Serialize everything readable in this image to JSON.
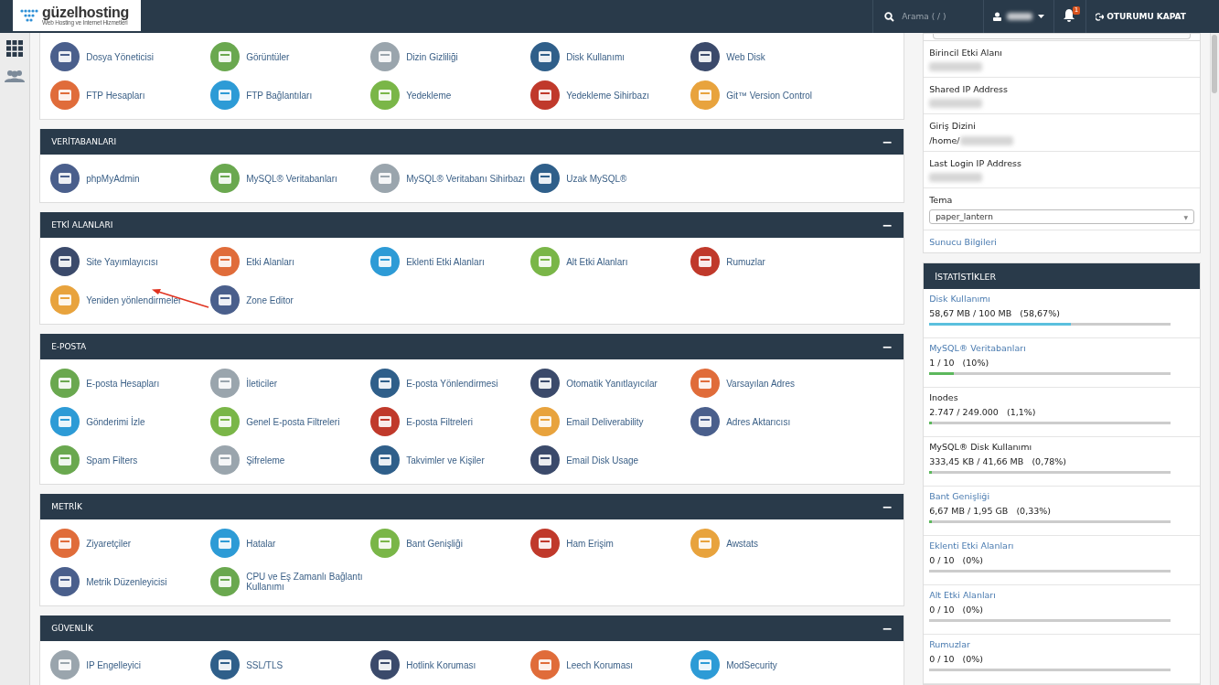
{
  "brand": {
    "name": "güzelhosting",
    "tagline": "Web Hosting ve İnternet Hizmetleri"
  },
  "topbar": {
    "search_placeholder": "Arama ( / )",
    "notification_count": "1",
    "logout": "OTURUMU KAPAT"
  },
  "sections": [
    {
      "items": [
        "Dosya Yöneticisi",
        "Görüntüler",
        "Dizin Gizliliği",
        "Disk Kullanımı",
        "Web Disk",
        "FTP Hesapları",
        "FTP Bağlantıları",
        "Yedekleme",
        "Yedekleme Sihirbazı",
        "Git™ Version Control"
      ]
    },
    {
      "title": "VERİTABANLARI",
      "toggle": "−",
      "items": [
        "phpMyAdmin",
        "MySQL® Veritabanları",
        "MySQL® Veritabanı Sihirbazı",
        "Uzak MySQL®"
      ]
    },
    {
      "title": "ETKİ ALANLARI",
      "toggle": "−",
      "items": [
        "Site Yayımlayıcısı",
        "Etki Alanları",
        "Eklenti Etki Alanları",
        "Alt Etki Alanları",
        "Rumuzlar",
        "Yeniden yönlendirmeler",
        "Zone Editor"
      ]
    },
    {
      "title": "E-POSTA",
      "toggle": "−",
      "items": [
        "E-posta Hesapları",
        "İleticiler",
        "E-posta Yönlendirmesi",
        "Otomatik Yanıtlayıcılar",
        "Varsayılan Adres",
        "Gönderimi İzle",
        "Genel E-posta Filtreleri",
        "E-posta Filtreleri",
        "Email Deliverability",
        "Adres Aktarıcısı",
        "Spam Filters",
        "Şifreleme",
        "Takvimler ve Kişiler",
        "Email Disk Usage"
      ]
    },
    {
      "title": "METRİK",
      "toggle": "−",
      "items": [
        "Ziyaretçiler",
        "Hatalar",
        "Bant Genişliği",
        "Ham Erişim",
        "Awstats",
        "Metrik Düzenleyicisi",
        "CPU ve Eş Zamanlı Bağlantı Kullanımı"
      ]
    },
    {
      "title": "GÜVENLİK",
      "toggle": "−",
      "items": [
        "IP Engelleyici",
        "SSL/TLS",
        "Hotlink Koruması",
        "Leech Koruması",
        "ModSecurity"
      ]
    }
  ],
  "info": [
    {
      "label": "Birincil Etki Alanı"
    },
    {
      "label": "Shared IP Address"
    },
    {
      "label": "Giriş Dizini",
      "value": "/home/"
    },
    {
      "label": "Last Login IP Address"
    }
  ],
  "theme": {
    "label": "Tema",
    "value": "paper_lantern",
    "caret": "▼"
  },
  "server_info_link": "Sunucu Bilgileri",
  "stats": {
    "title": "İSTATİSTİKLER",
    "items": [
      {
        "label": "Disk Kullanımı",
        "link": true,
        "value": "58,67 MB / 100 MB",
        "percent": "(58,67%)",
        "level": 0.5867,
        "color": "#5bc0de"
      },
      {
        "label": "MySQL® Veritabanları",
        "link": true,
        "value": "1 / 10",
        "percent": "(10%)",
        "level": 0.1,
        "color": "#5cb85c"
      },
      {
        "label": "Inodes",
        "link": false,
        "value": "2.747 / 249.000",
        "percent": "(1,1%)",
        "level": 0.011,
        "color": "#5cb85c"
      },
      {
        "label": "MySQL® Disk Kullanımı",
        "link": false,
        "value": "333,45 KB / 41,66 MB",
        "percent": "(0,78%)",
        "level": 0.0078,
        "color": "#5cb85c"
      },
      {
        "label": "Bant Genişliği",
        "link": true,
        "value": "6,67 MB / 1,95 GB",
        "percent": "(0,33%)",
        "level": 0.0033,
        "color": "#5cb85c"
      },
      {
        "label": "Eklenti Etki Alanları",
        "link": true,
        "value": "0 / 10",
        "percent": "(0%)"
      },
      {
        "label": "Alt Etki Alanları",
        "link": true,
        "value": "0 / 10",
        "percent": "(0%)"
      },
      {
        "label": "Rumuzlar",
        "link": true,
        "value": "0 / 10",
        "percent": "(0%)"
      }
    ]
  }
}
